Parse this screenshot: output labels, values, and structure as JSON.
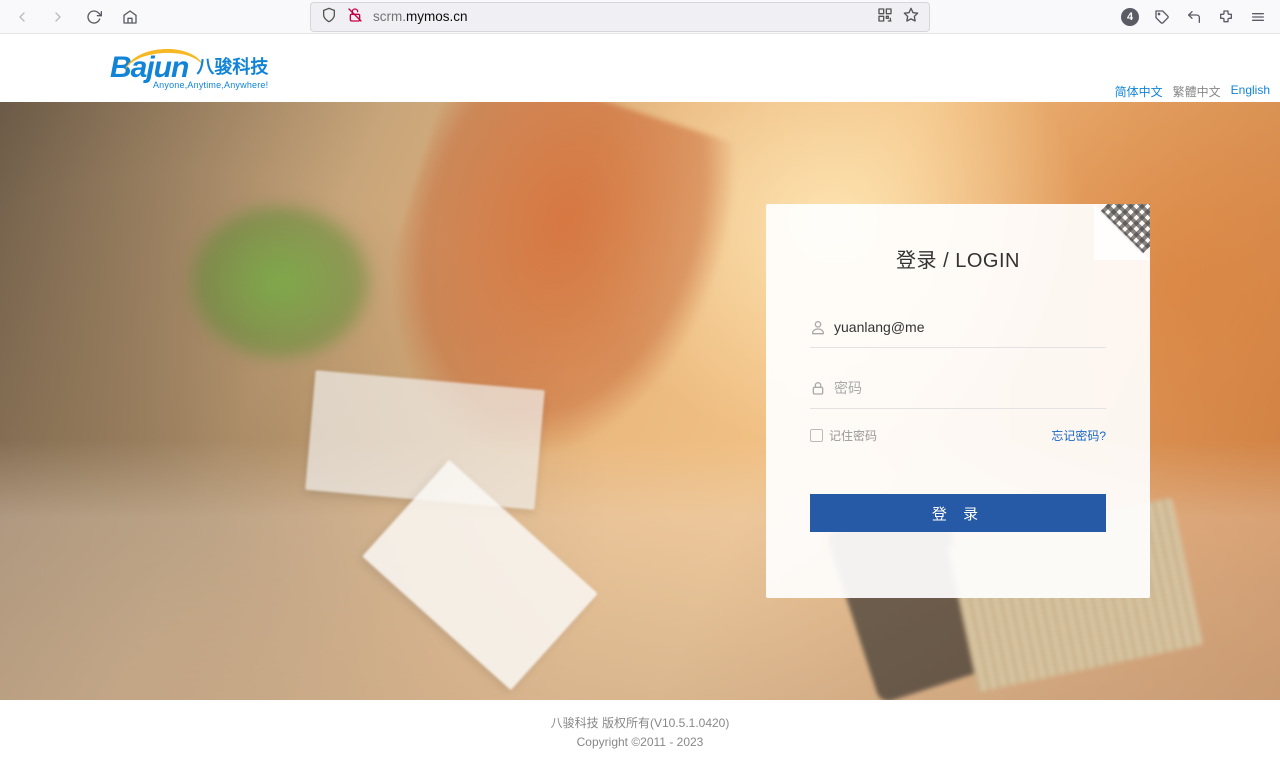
{
  "browser": {
    "url_sub": "scrm.",
    "url_domain": "mymos.cn",
    "badge_count": "4"
  },
  "header": {
    "logo_main": "Bajun",
    "logo_cn": "八骏科技",
    "logo_tagline": "Anyone,Anytime,Anywhere!",
    "lang": {
      "simplified": "简体中文",
      "traditional": "繁體中文",
      "english": "English"
    }
  },
  "login": {
    "title": "登录 / LOGIN",
    "username_value": "yuanlang@me",
    "password_placeholder": "密码",
    "remember_label": "记住密码",
    "forgot_label": "忘记密码?",
    "submit_label": "登  录"
  },
  "footer": {
    "line1": "八骏科技 版权所有(V10.5.1.0420)",
    "line2": "Copyright ©2011 - 2023"
  }
}
